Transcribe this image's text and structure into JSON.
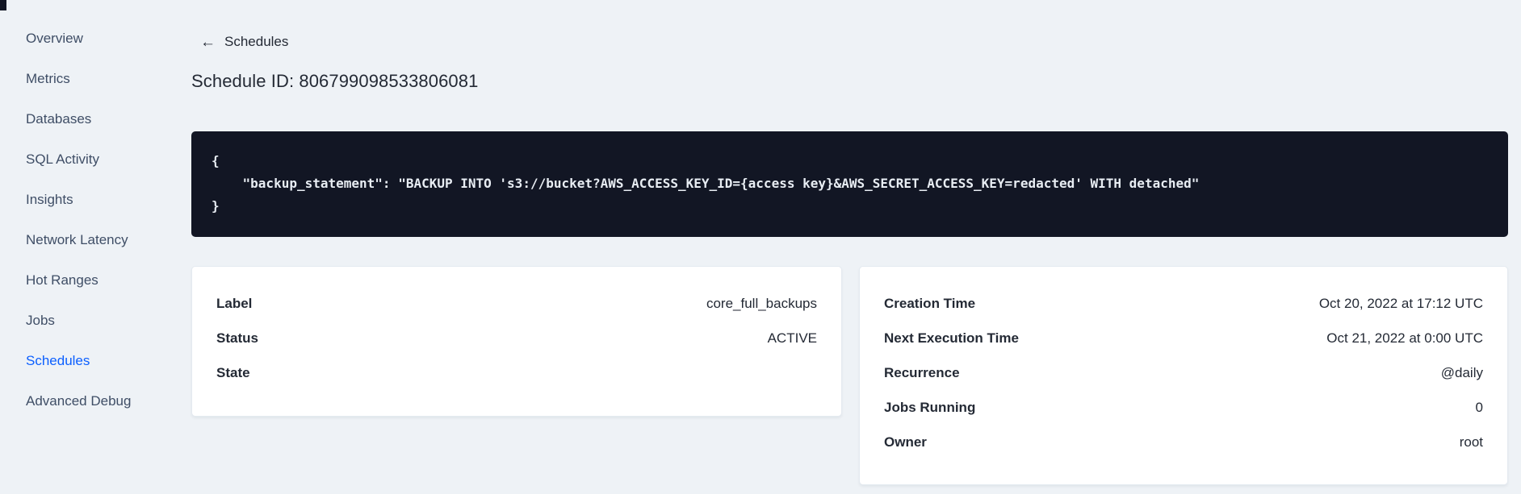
{
  "sidebar": {
    "items": [
      {
        "label": "Overview",
        "active": false
      },
      {
        "label": "Metrics",
        "active": false
      },
      {
        "label": "Databases",
        "active": false
      },
      {
        "label": "SQL Activity",
        "active": false
      },
      {
        "label": "Insights",
        "active": false
      },
      {
        "label": "Network Latency",
        "active": false
      },
      {
        "label": "Hot Ranges",
        "active": false
      },
      {
        "label": "Jobs",
        "active": false
      },
      {
        "label": "Schedules",
        "active": true
      },
      {
        "label": "Advanced Debug",
        "active": false
      }
    ]
  },
  "header": {
    "back_icon": "←",
    "back_label": "Schedules",
    "title": "Schedule ID: 806799098533806081"
  },
  "code_block": {
    "lines": [
      "{",
      "    \"backup_statement\": \"BACKUP INTO 's3://bucket?AWS_ACCESS_KEY_ID={access key}&AWS_SECRET_ACCESS_KEY=redacted' WITH detached\"",
      "}"
    ]
  },
  "details_card": {
    "rows": [
      {
        "label": "Label",
        "value": "core_full_backups"
      },
      {
        "label": "Status",
        "value": "ACTIVE"
      },
      {
        "label": "State",
        "value": ""
      }
    ]
  },
  "schedule_card": {
    "rows": [
      {
        "label": "Creation Time",
        "value": "Oct 20, 2022 at 17:12 UTC"
      },
      {
        "label": "Next Execution Time",
        "value": "Oct 21, 2022 at 0:00 UTC"
      },
      {
        "label": "Recurrence",
        "value": "@daily"
      },
      {
        "label": "Jobs Running",
        "value": "0"
      },
      {
        "label": "Owner",
        "value": "root"
      }
    ]
  },
  "colors": {
    "page_background": "#eef2f6",
    "accent_blue": "#0b5fff",
    "text_dark": "#242a35",
    "sidebar_text": "#3f4e66",
    "code_background": "#121624",
    "code_text": "#e8edf3",
    "card_background": "#ffffff"
  }
}
